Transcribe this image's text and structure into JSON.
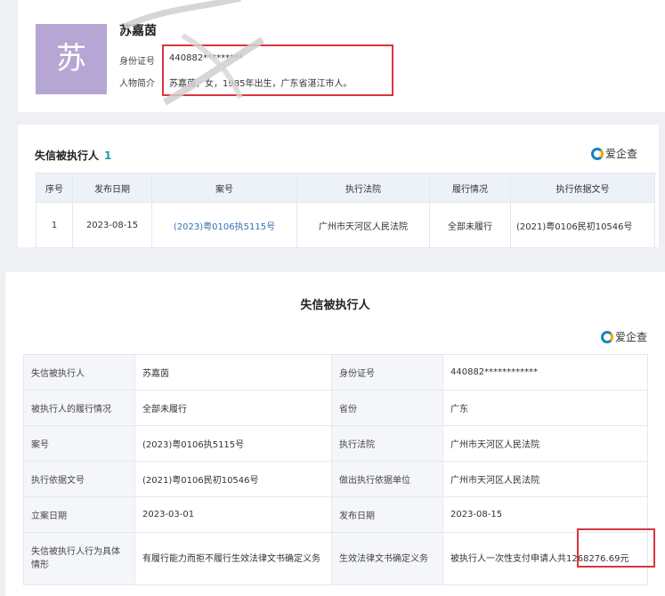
{
  "profile": {
    "avatar_char": "苏",
    "name": "苏嘉茵",
    "id_label": "身份证号",
    "id_value": "440882*********",
    "bio_label": "人物简介",
    "bio_value": "苏嘉茵，女，1985年出生，广东省湛江市人。"
  },
  "summary": {
    "title": "失信被执行人",
    "count": "1",
    "brand": "爱企查",
    "columns": [
      "序号",
      "发布日期",
      "案号",
      "执行法院",
      "履行情况",
      "执行依据文号"
    ],
    "rows": [
      {
        "no": "1",
        "date": "2023-08-15",
        "case_no": "(2023)粤0106执5115号",
        "court": "广州市天河区人民法院",
        "status": "全部未履行",
        "basis_no": "(2021)粤0106民初10546号"
      }
    ]
  },
  "detail": {
    "title": "失信被执行人",
    "brand": "爱企查",
    "rows": [
      {
        "k1": "失信被执行人",
        "v1": "苏嘉茵",
        "k2": "身份证号",
        "v2": "440882************"
      },
      {
        "k1": "被执行人的履行情况",
        "v1": "全部未履行",
        "k2": "省份",
        "v2": "广东"
      },
      {
        "k1": "案号",
        "v1": "(2023)粤0106执5115号",
        "k2": "执行法院",
        "v2": "广州市天河区人民法院"
      },
      {
        "k1": "执行依据文号",
        "v1": "(2021)粤0106民初10546号",
        "k2": "做出执行依据单位",
        "v2": "广州市天河区人民法院"
      },
      {
        "k1": "立案日期",
        "v1": "2023-03-01",
        "k2": "发布日期",
        "v2": "2023-08-15"
      },
      {
        "k1": "失信被执行人行为具体情形",
        "v1": "有履行能力而拒不履行生效法律文书确定义务",
        "k2": "生效法律文书确定义务",
        "v2": "被执行人一次性支付申请人共1268276.69元"
      }
    ]
  },
  "colors": {
    "accent": "#1a9ea8",
    "link": "#3a6fb5",
    "highlight": "#d9363e",
    "avatar": "#b5a6d3"
  }
}
